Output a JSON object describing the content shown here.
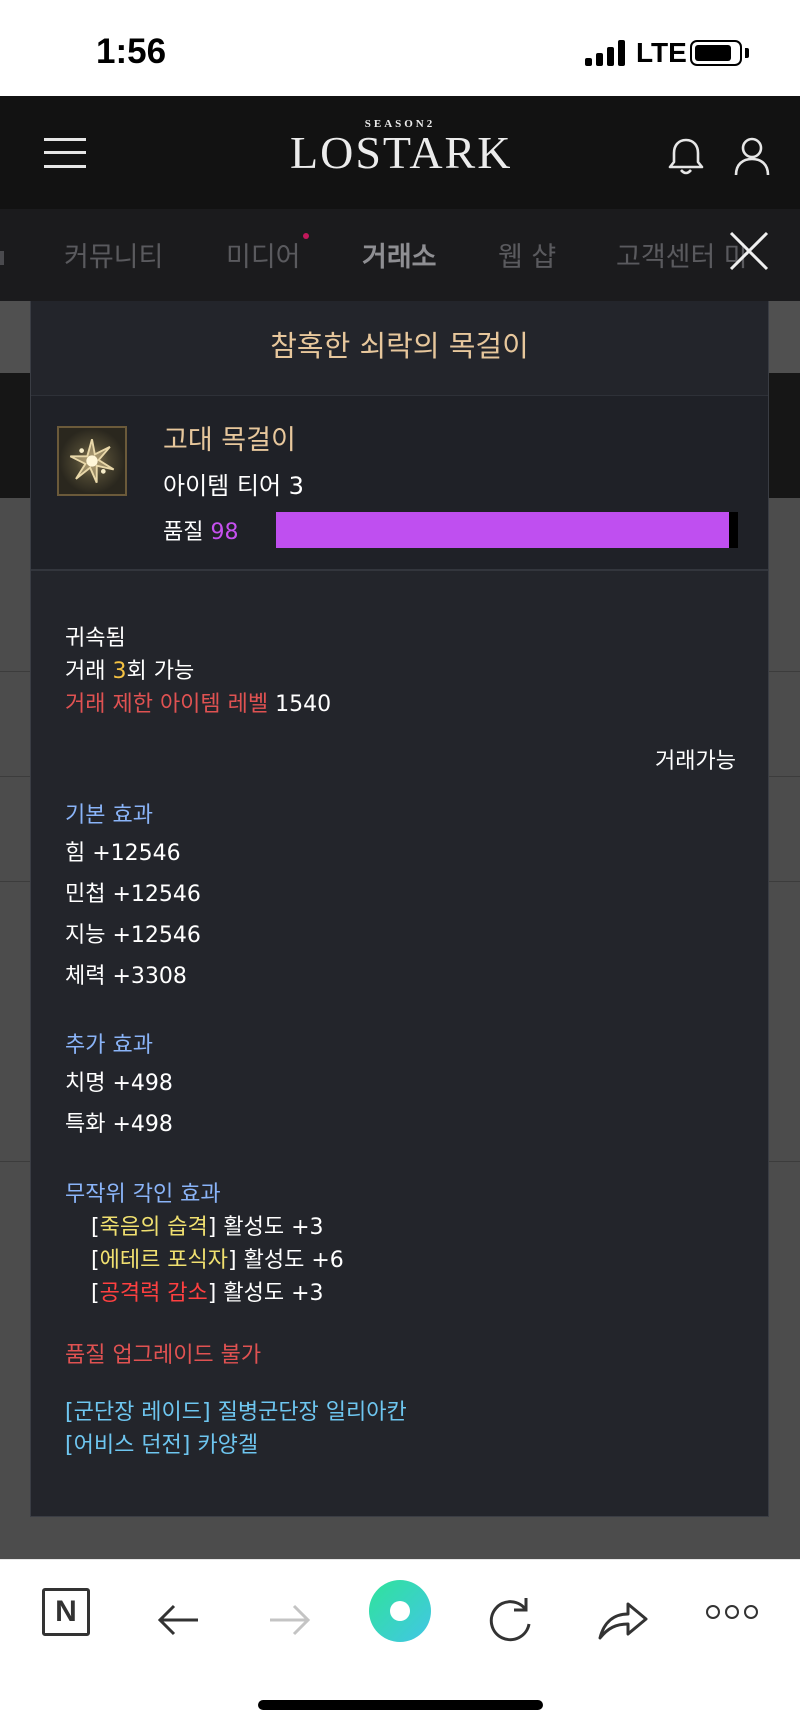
{
  "status_bar": {
    "time": "1:56",
    "network": "LTE"
  },
  "header": {
    "logo_season": "SEASON2",
    "logo_title": "LOSTARK"
  },
  "nav": {
    "items": [
      {
        "label": "커뮤니티"
      },
      {
        "label": "미디어"
      },
      {
        "label": "거래소"
      },
      {
        "label": "웹 샵"
      },
      {
        "label": "고객센터 마"
      }
    ],
    "active": "거래소",
    "accent_color": "#c2185b"
  },
  "tooltip": {
    "title": "참혹한 쇠락의 목걸이",
    "item_type": "고대 목걸이",
    "tier": "아이템 티어 3",
    "quality_label": "품질",
    "quality_value": "98",
    "quality_percent": 98,
    "quality_color": "#bf4ff0",
    "bound": "귀속됨",
    "trade_prefix": "거래 ",
    "trade_count": "3",
    "trade_suffix": "회 가능",
    "trade_restrict_label": "거래 제한 아이템 레벨",
    "trade_restrict_level": "1540",
    "tradable": "거래가능",
    "base_effects": {
      "title": "기본 효과",
      "items": [
        "힘 +12546",
        "민첩 +12546",
        "지능 +12546",
        "체력 +3308"
      ]
    },
    "extra_effects": {
      "title": "추가 효과",
      "items": [
        "치명 +498",
        "특화 +498"
      ]
    },
    "engravings": {
      "title": "무작위 각인 효과",
      "items": [
        {
          "name": "죽음의 습격",
          "value": "활성도 +3",
          "color": "yellow"
        },
        {
          "name": "에테르 포식자",
          "value": "활성도 +6",
          "color": "yellow"
        },
        {
          "name": "공격력 감소",
          "value": "활성도 +3",
          "color": "red"
        }
      ]
    },
    "upgrade_notice": "품질 업그레이드 불가",
    "sources": [
      "[군단장 레이드] 질병군단장 일리아칸",
      "[어비스 던전] 카양겔"
    ]
  },
  "toolbar": {
    "n_label": "N"
  }
}
